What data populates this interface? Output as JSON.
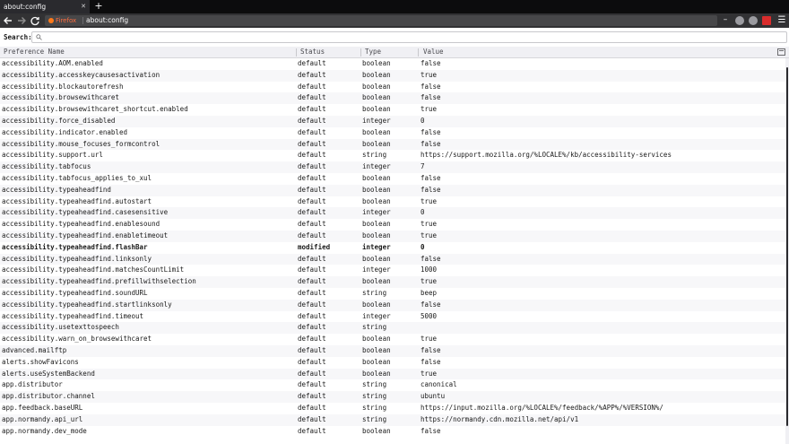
{
  "tab": {
    "title": "about:config"
  },
  "nav": {
    "identity_label": "Firefox",
    "url": "about:config",
    "icons": {
      "back": "back-arrow-icon",
      "forward": "forward-arrow-icon",
      "reload": "reload-icon",
      "minimize": "minimize-icon",
      "menu": "hamburger-menu-icon"
    }
  },
  "search": {
    "label": "Search:",
    "placeholder": ""
  },
  "columns": {
    "name": "Preference Name",
    "status": "Status",
    "type": "Type",
    "value": "Value"
  },
  "preferences": [
    {
      "name": "accessibility.AOM.enabled",
      "status": "default",
      "type": "boolean",
      "value": "false"
    },
    {
      "name": "accessibility.accesskeycausesactivation",
      "status": "default",
      "type": "boolean",
      "value": "true"
    },
    {
      "name": "accessibility.blockautorefresh",
      "status": "default",
      "type": "boolean",
      "value": "false"
    },
    {
      "name": "accessibility.browsewithcaret",
      "status": "default",
      "type": "boolean",
      "value": "false"
    },
    {
      "name": "accessibility.browsewithcaret_shortcut.enabled",
      "status": "default",
      "type": "boolean",
      "value": "true"
    },
    {
      "name": "accessibility.force_disabled",
      "status": "default",
      "type": "integer",
      "value": "0"
    },
    {
      "name": "accessibility.indicator.enabled",
      "status": "default",
      "type": "boolean",
      "value": "false"
    },
    {
      "name": "accessibility.mouse_focuses_formcontrol",
      "status": "default",
      "type": "boolean",
      "value": "false"
    },
    {
      "name": "accessibility.support.url",
      "status": "default",
      "type": "string",
      "value": "https://support.mozilla.org/%LOCALE%/kb/accessibility-services"
    },
    {
      "name": "accessibility.tabfocus",
      "status": "default",
      "type": "integer",
      "value": "7"
    },
    {
      "name": "accessibility.tabfocus_applies_to_xul",
      "status": "default",
      "type": "boolean",
      "value": "false"
    },
    {
      "name": "accessibility.typeaheadfind",
      "status": "default",
      "type": "boolean",
      "value": "false"
    },
    {
      "name": "accessibility.typeaheadfind.autostart",
      "status": "default",
      "type": "boolean",
      "value": "true"
    },
    {
      "name": "accessibility.typeaheadfind.casesensitive",
      "status": "default",
      "type": "integer",
      "value": "0"
    },
    {
      "name": "accessibility.typeaheadfind.enablesound",
      "status": "default",
      "type": "boolean",
      "value": "true"
    },
    {
      "name": "accessibility.typeaheadfind.enabletimeout",
      "status": "default",
      "type": "boolean",
      "value": "true"
    },
    {
      "name": "accessibility.typeaheadfind.flashBar",
      "status": "modified",
      "type": "integer",
      "value": "0"
    },
    {
      "name": "accessibility.typeaheadfind.linksonly",
      "status": "default",
      "type": "boolean",
      "value": "false"
    },
    {
      "name": "accessibility.typeaheadfind.matchesCountLimit",
      "status": "default",
      "type": "integer",
      "value": "1000"
    },
    {
      "name": "accessibility.typeaheadfind.prefillwithselection",
      "status": "default",
      "type": "boolean",
      "value": "true"
    },
    {
      "name": "accessibility.typeaheadfind.soundURL",
      "status": "default",
      "type": "string",
      "value": "beep"
    },
    {
      "name": "accessibility.typeaheadfind.startlinksonly",
      "status": "default",
      "type": "boolean",
      "value": "false"
    },
    {
      "name": "accessibility.typeaheadfind.timeout",
      "status": "default",
      "type": "integer",
      "value": "5000"
    },
    {
      "name": "accessibility.usetexttospeech",
      "status": "default",
      "type": "string",
      "value": ""
    },
    {
      "name": "accessibility.warn_on_browsewithcaret",
      "status": "default",
      "type": "boolean",
      "value": "true"
    },
    {
      "name": "advanced.mailftp",
      "status": "default",
      "type": "boolean",
      "value": "false"
    },
    {
      "name": "alerts.showFavicons",
      "status": "default",
      "type": "boolean",
      "value": "false"
    },
    {
      "name": "alerts.useSystemBackend",
      "status": "default",
      "type": "boolean",
      "value": "true"
    },
    {
      "name": "app.distributor",
      "status": "default",
      "type": "string",
      "value": "canonical"
    },
    {
      "name": "app.distributor.channel",
      "status": "default",
      "type": "string",
      "value": "ubuntu"
    },
    {
      "name": "app.feedback.baseURL",
      "status": "default",
      "type": "string",
      "value": "https://input.mozilla.org/%LOCALE%/feedback/%APP%/%VERSION%/"
    },
    {
      "name": "app.normandy.api_url",
      "status": "default",
      "type": "string",
      "value": "https://normandy.cdn.mozilla.net/api/v1"
    },
    {
      "name": "app.normandy.dev_mode",
      "status": "default",
      "type": "boolean",
      "value": "false"
    }
  ]
}
